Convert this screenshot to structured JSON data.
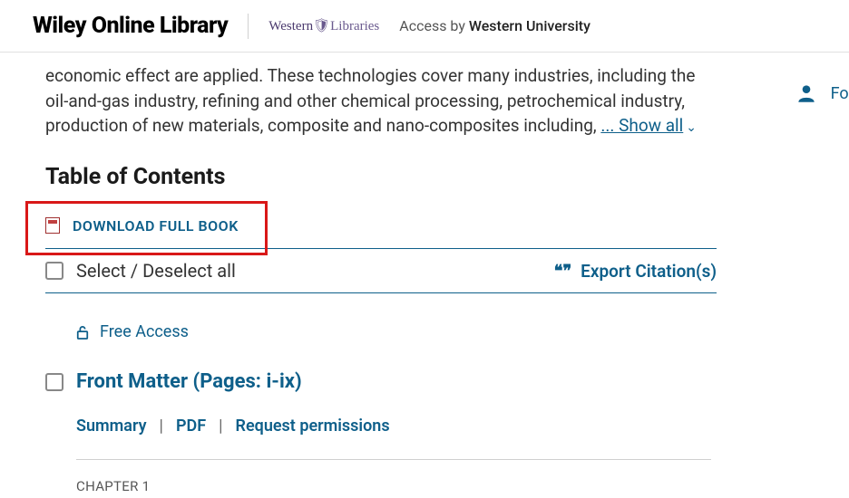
{
  "header": {
    "brand": "Wiley Online Library",
    "institution_logo": "Western",
    "institution_logo_suffix": "Libraries",
    "access_label": "Access by",
    "institution_name": "Western University"
  },
  "right": {
    "for_a_label": "For a"
  },
  "abstract": {
    "text": "economic effect are applied. These technologies cover many industries, including the oil-and-gas industry, refining and other chemical processing, petrochemical industry, production of new materials, composite and nano-composites including, ",
    "show_all": "... Show all"
  },
  "toc": {
    "heading": "Table of Contents",
    "download_label": "DOWNLOAD FULL BOOK",
    "select_label": "Select / Deselect all",
    "export_label": "Export Citation(s)",
    "free_access": "Free Access",
    "chapter": {
      "title": "Front Matter (Pages: i-ix)",
      "summary": "Summary",
      "pdf": "PDF",
      "permissions": "Request permissions"
    },
    "chapter_label": "CHAPTER 1"
  }
}
